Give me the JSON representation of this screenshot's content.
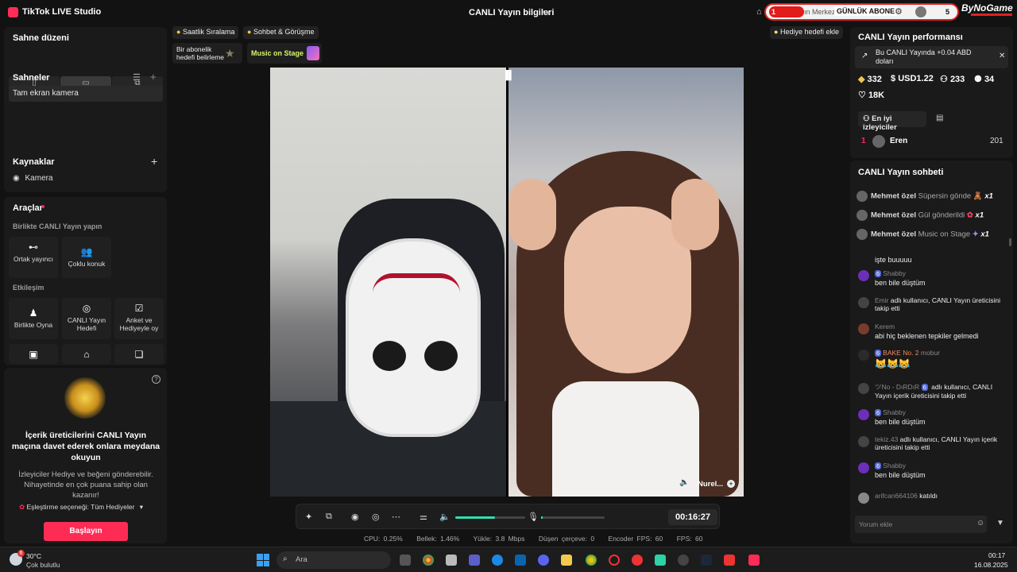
{
  "titlebar": {
    "app_name": "TikTok LIVE Studio",
    "center_title": "CANLI Yayın bilgileri",
    "overlay": {
      "red_label": "1",
      "merkez": "ın Merkez",
      "abone": "GÜNLÜK ABONE",
      "count": "5"
    },
    "brand": "ByNoGame"
  },
  "left": {
    "scene_layout_title": "Sahne düzeni",
    "scenes_title": "Sahneler",
    "scene_items": [
      "Tam ekran kamera"
    ],
    "sources_title": "Kaynaklar",
    "source_items": [
      "Kamera"
    ],
    "tools_title": "Araçlar",
    "collab_title": "Birlikte CANLI Yayın yapın",
    "collab_tools": [
      "Ortak yayıncı",
      "Çoklu konuk"
    ],
    "interaction_title": "Etkileşim",
    "interaction_tools": [
      "Birlikte Oyna",
      "CANLI Yayın Hedefi",
      "Anket ve Hediyeyle oy"
    ],
    "invite": {
      "heading": "İçerik üreticilerini CANLI Yayın maçına davet ederek onlara meydana okuyun",
      "body": "İzleyiciler Hediye ve beğeni gönderebilir. Nihayetinde en çok puana sahip olan kazanır!",
      "match_option": "Eşleştirme seçeneği: Tüm Hediyeler",
      "start": "Başlayın"
    }
  },
  "center": {
    "chips": [
      "Saatlik Sıralama",
      "Sohbet & Görüşme"
    ],
    "gift_goal_chip": "Hediye hedefi ekle",
    "goal_card": "Bir abonelik hedefi belirleme",
    "music_card": "Music on Stage",
    "guest_name": "Nurel...",
    "timer": "00:16:27",
    "volume_level": 0.57,
    "stats": {
      "cpu": "CPU:  0.25%",
      "memory": "Bellek:  1.46%",
      "upload": "Yükle:  3.8 Mbps",
      "dropped": "Düşen çerçeve:  0",
      "encoder": "Encoder FPS:  60",
      "fps": "FPS:  60"
    }
  },
  "right": {
    "perf_title": "CANLI Yayın performansı",
    "earn_text": "Bu CANLI Yayında +0.04 ABD doları",
    "stats": [
      "332",
      "USD1.22",
      "233",
      "34"
    ],
    "likes": "18K",
    "top_viewers_btn": "En iyi izleyiciler",
    "top_viewer": {
      "rank": "1",
      "name": "Eren",
      "score": "201"
    },
    "chat_title": "CANLI Yayın sohbeti",
    "gift_rows": [
      {
        "name": "Mehmet özel",
        "msg": "Süpersin gönde",
        "count": "x1"
      },
      {
        "name": "Mehmet özel",
        "msg": "Gül gönderildi",
        "count": "x1"
      },
      {
        "name": "Mehmet özel",
        "msg": "Music on Stage",
        "count": "x1"
      }
    ],
    "messages": [
      {
        "name": "",
        "text": "işte buuuuu"
      },
      {
        "name": "Shabby",
        "badge": "6",
        "text": "ben bile düştüm"
      },
      {
        "name": "Emir",
        "text": "adlı kullanıcı, CANLI Yayın üreticisini takip etti"
      },
      {
        "name": "Kerem",
        "text": "abi hiç beklenen tepkiler gelmedi"
      },
      {
        "name": "mobur",
        "badge": "6",
        "extra": "BAKE  No. 2",
        "text": ""
      },
      {
        "name": "ツNo - DıRDıR",
        "badge": "6",
        "text": "adlı kullanıcı, CANLI Yayın içerik üreticisini takip etti"
      },
      {
        "name": "Shabby",
        "badge": "6",
        "text": "ben bile düştüm"
      },
      {
        "name": "tekiz.43",
        "text": "adlı kullanıcı, CANLI Yayın içerik üreticisini takip etti"
      },
      {
        "name": "Shabby",
        "badge": "6",
        "text": "ben bile düştüm"
      },
      {
        "name": "arifcan664106",
        "text": "katıldı"
      }
    ],
    "comment_placeholder": "Yorum ekle"
  },
  "taskbar": {
    "weather_temp": "30°C",
    "weather_desc": "Çok bulutlu",
    "weather_badge": "6",
    "search_placeholder": "Ara",
    "time": "00:17",
    "date": "16.08.2025"
  }
}
